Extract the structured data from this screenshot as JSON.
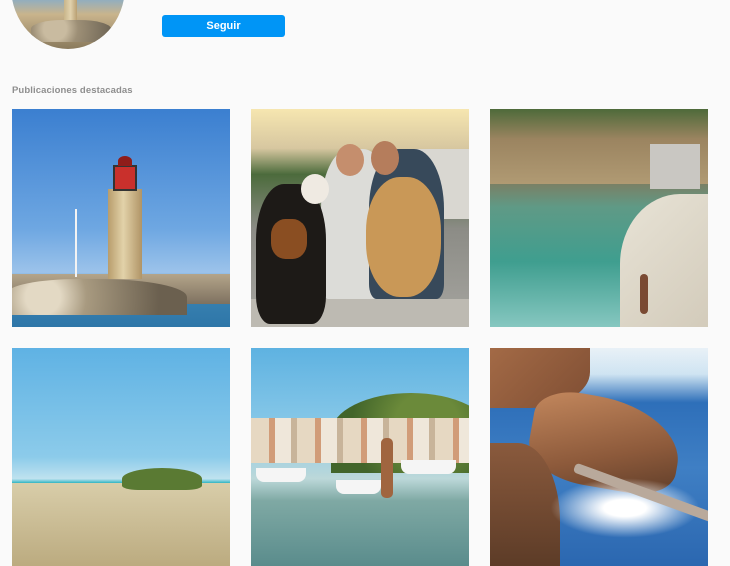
{
  "profile": {
    "follow_label": "Seguir"
  },
  "featured": {
    "section_label": "Publicaciones destacadas",
    "posts": [
      {
        "subject": "lighthouse"
      },
      {
        "subject": "couple with dogs"
      },
      {
        "subject": "cove"
      },
      {
        "subject": "beach"
      },
      {
        "subject": "harbour"
      },
      {
        "subject": "rocky coast"
      }
    ]
  },
  "colors": {
    "accent": "#0095f6",
    "muted_text": "#8e8e8e",
    "background": "#fafafa"
  }
}
